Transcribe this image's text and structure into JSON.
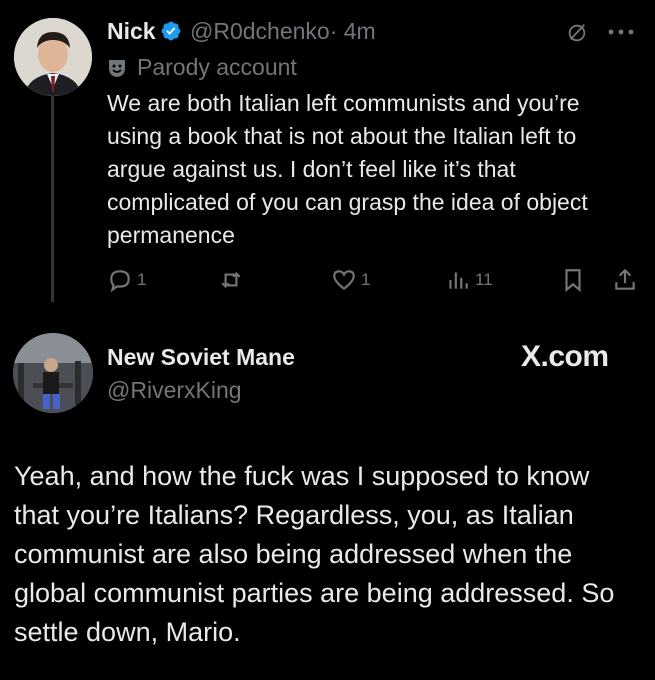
{
  "reply": {
    "display_name": "Nick",
    "handle": "@R0dchenko",
    "time": "· 4m",
    "badge": "Parody account",
    "text": "We are both Italian left communists and you’re using a book that is not about the Italian left to argue against us. I don’t feel like it’s that complicated of you can grasp the idea of object permanence",
    "actions": {
      "replies": "1",
      "reposts": "",
      "likes": "1",
      "views": "11"
    },
    "icons": [
      "verified-icon",
      "grok-icon",
      "more-icon",
      "parody-mask-icon",
      "reply-icon",
      "repost-icon",
      "like-icon",
      "views-icon",
      "bookmark-icon",
      "share-icon"
    ]
  },
  "quoted": {
    "display_name": "New Soviet Mane",
    "handle": "@RiverxKing",
    "watermark": "X.com",
    "text": "Yeah, and how the fuck was I supposed to know that you’re Italians? Regardless, you, as Italian communist are also being addressed when the global communist parties are being addressed. So settle down, Mario."
  },
  "colors": {
    "background": "#000000",
    "text": "#e7e9ea",
    "muted": "#71767b",
    "verified": "#1d9bf0"
  }
}
